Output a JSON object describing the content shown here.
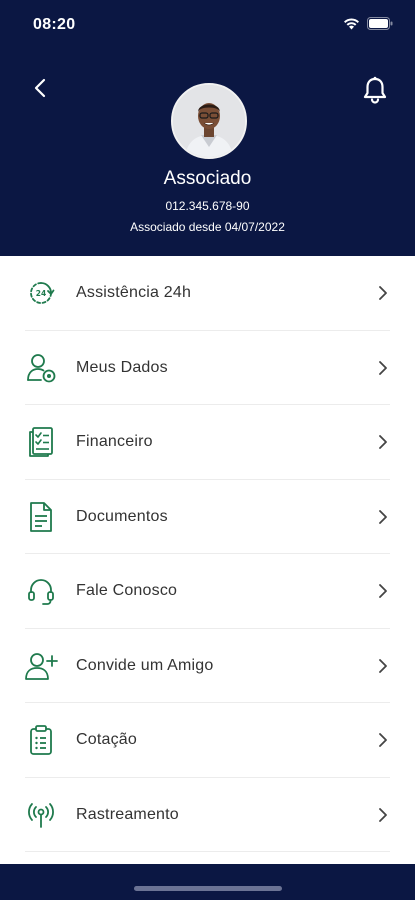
{
  "status_bar": {
    "time": "08:20"
  },
  "profile": {
    "name": "Associado",
    "cpf": "012.345.678-90",
    "member_since": "Associado desde 04/07/2022"
  },
  "colors": {
    "header_bg": "#0b1743",
    "icon_green": "#1f7a4d",
    "text": "#333333"
  },
  "menu": {
    "items": [
      {
        "label": "Assistência 24h",
        "icon": "clock-24h-icon"
      },
      {
        "label": "Meus Dados",
        "icon": "user-settings-icon"
      },
      {
        "label": "Financeiro",
        "icon": "checklist-document-icon"
      },
      {
        "label": "Documentos",
        "icon": "document-icon"
      },
      {
        "label": "Fale Conosco",
        "icon": "headset-icon"
      },
      {
        "label": "Convide um Amigo",
        "icon": "add-user-icon"
      },
      {
        "label": "Cotação",
        "icon": "clipboard-list-icon"
      },
      {
        "label": "Rastreamento",
        "icon": "signal-antenna-icon"
      }
    ]
  }
}
